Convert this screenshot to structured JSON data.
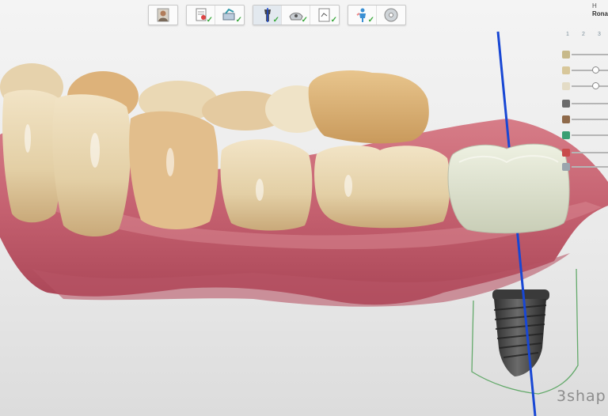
{
  "workflow": {
    "groups": [
      {
        "steps": [
          {
            "icon": "patient-portrait-icon",
            "done": false,
            "active": false
          }
        ]
      },
      {
        "steps": [
          {
            "icon": "order-form-icon",
            "done": true,
            "active": false
          },
          {
            "icon": "scan-import-icon",
            "done": true,
            "active": false
          }
        ]
      },
      {
        "steps": [
          {
            "icon": "implant-planning-icon",
            "done": true,
            "active": true
          },
          {
            "icon": "guide-design-icon",
            "done": true,
            "active": false
          },
          {
            "icon": "report-icon",
            "done": true,
            "active": false
          }
        ]
      },
      {
        "steps": [
          {
            "icon": "surgeon-icon",
            "done": true,
            "active": false
          },
          {
            "icon": "export-disc-icon",
            "done": false,
            "active": false
          }
        ]
      }
    ],
    "check_mark": "✓"
  },
  "header": {
    "line1": "H",
    "line2": "Rona"
  },
  "right_panel": {
    "tabs": [
      "1",
      "2",
      "3"
    ],
    "visibility_rows": [
      {
        "icon": "crown-object-icon",
        "color": "#c7b98a",
        "level": 1.0
      },
      {
        "icon": "tooth-object-icon",
        "color": "#d8c79a",
        "level": 0.6
      },
      {
        "icon": "tooth-object-icon",
        "color": "#e4dcc6",
        "level": 0.6
      },
      {
        "icon": "implant-object-icon",
        "color": "#6b6b6b",
        "level": 1.0
      },
      {
        "icon": "abutment-object-icon",
        "color": "#8f6a4a",
        "level": 1.0
      },
      {
        "icon": "dna-object-icon",
        "color": "#3a9f72",
        "level": 1.0
      },
      {
        "icon": "cut-object-icon",
        "color": "#c84b4b",
        "level": 1.0
      },
      {
        "icon": "nerve-object-icon",
        "color": "#9aa5ad",
        "level": 1.0
      }
    ]
  },
  "logo": {
    "text": "3shap"
  },
  "colors": {
    "gum": "#c96b78",
    "tooth": "#e7d7b7",
    "crown": "#e3e7d6",
    "implant": "#3e3e3e",
    "axis": "#1847d4",
    "guide": "#63a96a"
  }
}
